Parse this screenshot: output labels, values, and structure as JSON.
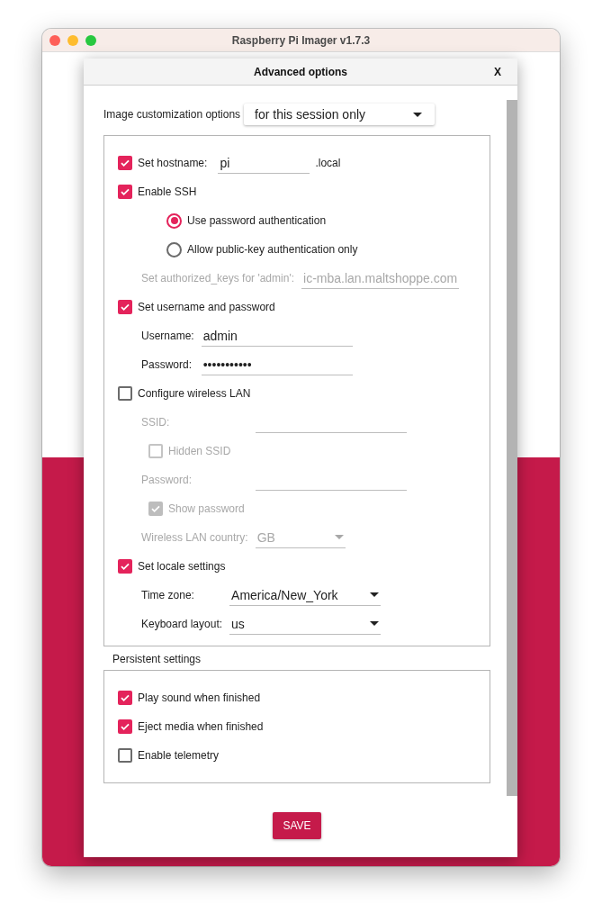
{
  "window": {
    "title": "Raspberry Pi Imager v1.7.3"
  },
  "dialog": {
    "title": "Advanced options",
    "close": "X"
  },
  "customization": {
    "label": "Image customization options",
    "value": "for this session only"
  },
  "sections": [
    {
      "kind": "hostname",
      "label": "Set hostname:",
      "checked": true,
      "value": "pi",
      "suffix": ".local"
    },
    {
      "kind": "group",
      "label": "Enable SSH",
      "checked": true,
      "children": [
        {
          "kind": "radio",
          "label": "Use password authentication",
          "selected": true
        },
        {
          "kind": "radio",
          "label": "Allow public-key authentication only",
          "selected": false
        },
        {
          "kind": "field",
          "label": "Set authorized_keys for 'admin':",
          "value": "ic-mba.lan.maltshoppe.com",
          "disabled": true
        }
      ]
    },
    {
      "kind": "group",
      "label": "Set username and password",
      "checked": true,
      "children": [
        {
          "kind": "field",
          "label": "Username:",
          "value": "admin",
          "disabled": false
        },
        {
          "kind": "field",
          "label": "Password:",
          "value": "•••••••••••",
          "disabled": false
        }
      ]
    },
    {
      "kind": "group",
      "label": "Configure wireless LAN",
      "checked": false,
      "children": [
        {
          "kind": "field",
          "label": "SSID:",
          "disabled": true
        },
        {
          "kind": "checkbox",
          "label": "Hidden SSID",
          "checked": false,
          "disabled": true
        },
        {
          "kind": "field",
          "label": "Password:",
          "disabled": true
        },
        {
          "kind": "checkbox",
          "label": "Show password",
          "checked": true,
          "disabled": true
        },
        {
          "kind": "dropdown",
          "label": "Wireless LAN country:",
          "value": "GB",
          "disabled": true
        }
      ]
    },
    {
      "kind": "group",
      "label": "Set locale settings",
      "checked": true,
      "children": [
        {
          "kind": "dropdown",
          "label": "Time zone:",
          "value": "America/New_York",
          "disabled": false
        },
        {
          "kind": "dropdown",
          "label": "Keyboard layout:",
          "value": "us",
          "disabled": false
        }
      ]
    }
  ],
  "persistent": {
    "title": "Persistent settings",
    "items": [
      {
        "label": "Play sound when finished",
        "checked": true
      },
      {
        "label": "Eject media when finished",
        "checked": true
      },
      {
        "label": "Enable telemetry",
        "checked": false
      }
    ]
  },
  "save": "SAVE"
}
